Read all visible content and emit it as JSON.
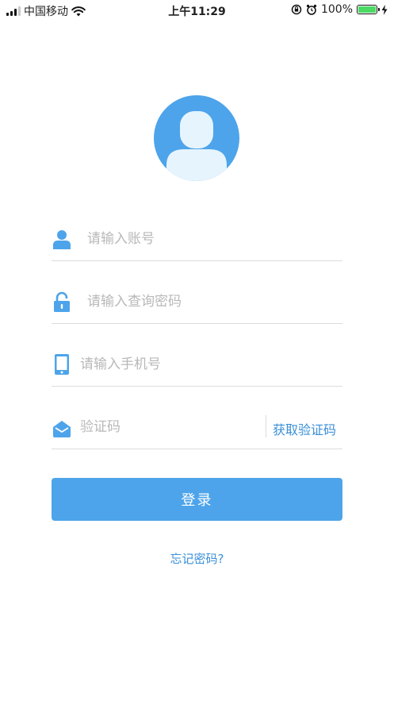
{
  "status_bar": {
    "carrier": "中国移动",
    "time": "上午11:29",
    "battery": "100%",
    "icons": [
      "signal-icon",
      "wifi-icon",
      "rotation-lock-icon",
      "alarm-icon",
      "battery-icon",
      "charging-icon"
    ]
  },
  "colors": {
    "accent": "#4da4ea",
    "link": "#3a8fd8",
    "avatar_bg": "#4da4ea",
    "avatar_fg": "#e6f4fd",
    "divider": "#dcdcdc"
  },
  "form": {
    "account_placeholder": "请输入账号",
    "password_placeholder": "请输入查询密码",
    "phone_placeholder": "请输入手机号",
    "code_placeholder": "验证码",
    "get_code_label": "获取验证码"
  },
  "login_label": "登录",
  "forgot_label": "忘记密码?"
}
